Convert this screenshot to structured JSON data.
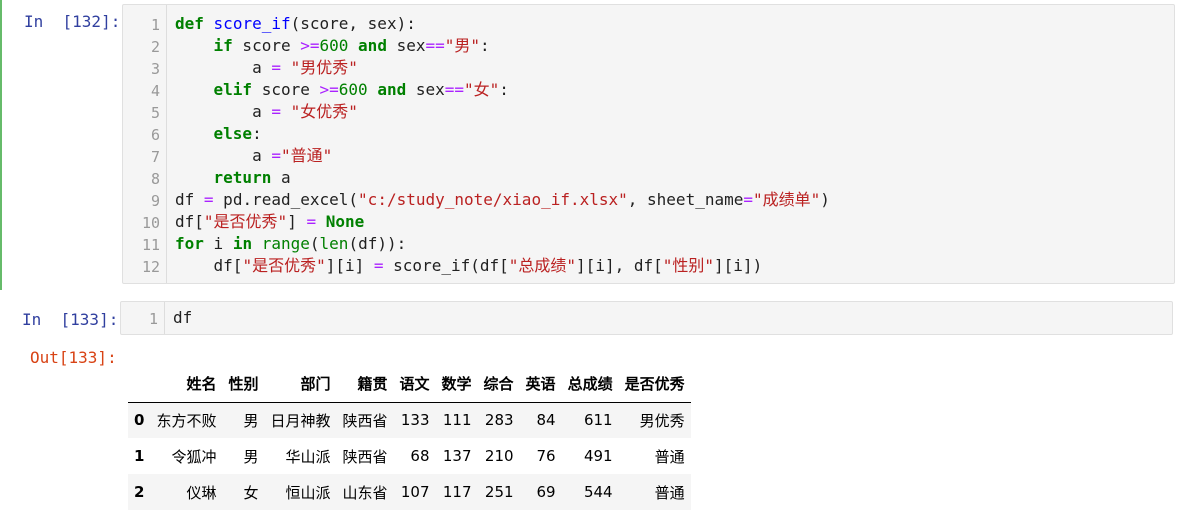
{
  "cell1": {
    "prompt": "In  [132]:",
    "line_numbers": [
      "1",
      "2",
      "3",
      "4",
      "5",
      "6",
      "7",
      "8",
      "9",
      "10",
      "11",
      "12"
    ],
    "lines": [
      [
        {
          "t": "def",
          "c": "kw"
        },
        {
          "t": " ",
          "c": "tx"
        },
        {
          "t": "score_if",
          "c": "fn"
        },
        {
          "t": "(score, sex):",
          "c": "tx"
        }
      ],
      [
        {
          "t": "    ",
          "c": "tx"
        },
        {
          "t": "if",
          "c": "kw"
        },
        {
          "t": " score ",
          "c": "tx"
        },
        {
          "t": ">=",
          "c": "op"
        },
        {
          "t": "600",
          "c": "num"
        },
        {
          "t": " ",
          "c": "tx"
        },
        {
          "t": "and",
          "c": "kw"
        },
        {
          "t": " sex",
          "c": "tx"
        },
        {
          "t": "==",
          "c": "op"
        },
        {
          "t": "\"男\"",
          "c": "str"
        },
        {
          "t": ":",
          "c": "tx"
        }
      ],
      [
        {
          "t": "        a ",
          "c": "tx"
        },
        {
          "t": "=",
          "c": "op"
        },
        {
          "t": " ",
          "c": "tx"
        },
        {
          "t": "\"男优秀\"",
          "c": "str"
        }
      ],
      [
        {
          "t": "    ",
          "c": "tx"
        },
        {
          "t": "elif",
          "c": "kw"
        },
        {
          "t": " score ",
          "c": "tx"
        },
        {
          "t": ">=",
          "c": "op"
        },
        {
          "t": "600",
          "c": "num"
        },
        {
          "t": " ",
          "c": "tx"
        },
        {
          "t": "and",
          "c": "kw"
        },
        {
          "t": " sex",
          "c": "tx"
        },
        {
          "t": "==",
          "c": "op"
        },
        {
          "t": "\"女\"",
          "c": "str"
        },
        {
          "t": ":",
          "c": "tx"
        }
      ],
      [
        {
          "t": "        a ",
          "c": "tx"
        },
        {
          "t": "=",
          "c": "op"
        },
        {
          "t": " ",
          "c": "tx"
        },
        {
          "t": "\"女优秀\"",
          "c": "str"
        }
      ],
      [
        {
          "t": "    ",
          "c": "tx"
        },
        {
          "t": "else",
          "c": "kw"
        },
        {
          "t": ":",
          "c": "tx"
        }
      ],
      [
        {
          "t": "        a ",
          "c": "tx"
        },
        {
          "t": "=",
          "c": "op"
        },
        {
          "t": "\"普通\"",
          "c": "str"
        }
      ],
      [
        {
          "t": "    ",
          "c": "tx"
        },
        {
          "t": "return",
          "c": "kw"
        },
        {
          "t": " a",
          "c": "tx"
        }
      ],
      [
        {
          "t": "df ",
          "c": "tx"
        },
        {
          "t": "=",
          "c": "op"
        },
        {
          "t": " pd.read_excel(",
          "c": "tx"
        },
        {
          "t": "\"c:/study_note/xiao_if.xlsx\"",
          "c": "str"
        },
        {
          "t": ", sheet_name",
          "c": "tx"
        },
        {
          "t": "=",
          "c": "op"
        },
        {
          "t": "\"成绩单\"",
          "c": "str"
        },
        {
          "t": ")",
          "c": "tx"
        }
      ],
      [
        {
          "t": "df[",
          "c": "tx"
        },
        {
          "t": "\"是否优秀\"",
          "c": "str"
        },
        {
          "t": "] ",
          "c": "tx"
        },
        {
          "t": "=",
          "c": "op"
        },
        {
          "t": " ",
          "c": "tx"
        },
        {
          "t": "None",
          "c": "kw"
        }
      ],
      [
        {
          "t": "for",
          "c": "kw"
        },
        {
          "t": " i ",
          "c": "tx"
        },
        {
          "t": "in",
          "c": "kw"
        },
        {
          "t": " ",
          "c": "tx"
        },
        {
          "t": "range",
          "c": "bi"
        },
        {
          "t": "(",
          "c": "tx"
        },
        {
          "t": "len",
          "c": "bi"
        },
        {
          "t": "(df)):",
          "c": "tx"
        }
      ],
      [
        {
          "t": "    df[",
          "c": "tx"
        },
        {
          "t": "\"是否优秀\"",
          "c": "str"
        },
        {
          "t": "][i] ",
          "c": "tx"
        },
        {
          "t": "=",
          "c": "op"
        },
        {
          "t": " score_if(df[",
          "c": "tx"
        },
        {
          "t": "\"总成绩\"",
          "c": "str"
        },
        {
          "t": "][i], df[",
          "c": "tx"
        },
        {
          "t": "\"性别\"",
          "c": "str"
        },
        {
          "t": "][i])",
          "c": "tx"
        }
      ]
    ]
  },
  "cell2": {
    "prompt": "In  [133]:",
    "out_prompt": "Out[133]:",
    "line_numbers": [
      "1"
    ],
    "lines": [
      [
        {
          "t": "df",
          "c": "tx"
        }
      ]
    ]
  },
  "dataframe": {
    "columns": [
      "",
      "姓名",
      "性别",
      "部门",
      "籍贯",
      "语文",
      "数学",
      "综合",
      "英语",
      "总成绩",
      "是否优秀"
    ],
    "rows": [
      [
        "0",
        "东方不败",
        "男",
        "日月神教",
        "陕西省",
        "133",
        "111",
        "283",
        "84",
        "611",
        "男优秀"
      ],
      [
        "1",
        "令狐冲",
        "男",
        "华山派",
        "陕西省",
        "68",
        "137",
        "210",
        "76",
        "491",
        "普通"
      ],
      [
        "2",
        "仪琳",
        "女",
        "恒山派",
        "山东省",
        "107",
        "117",
        "251",
        "69",
        "544",
        "普通"
      ]
    ]
  }
}
